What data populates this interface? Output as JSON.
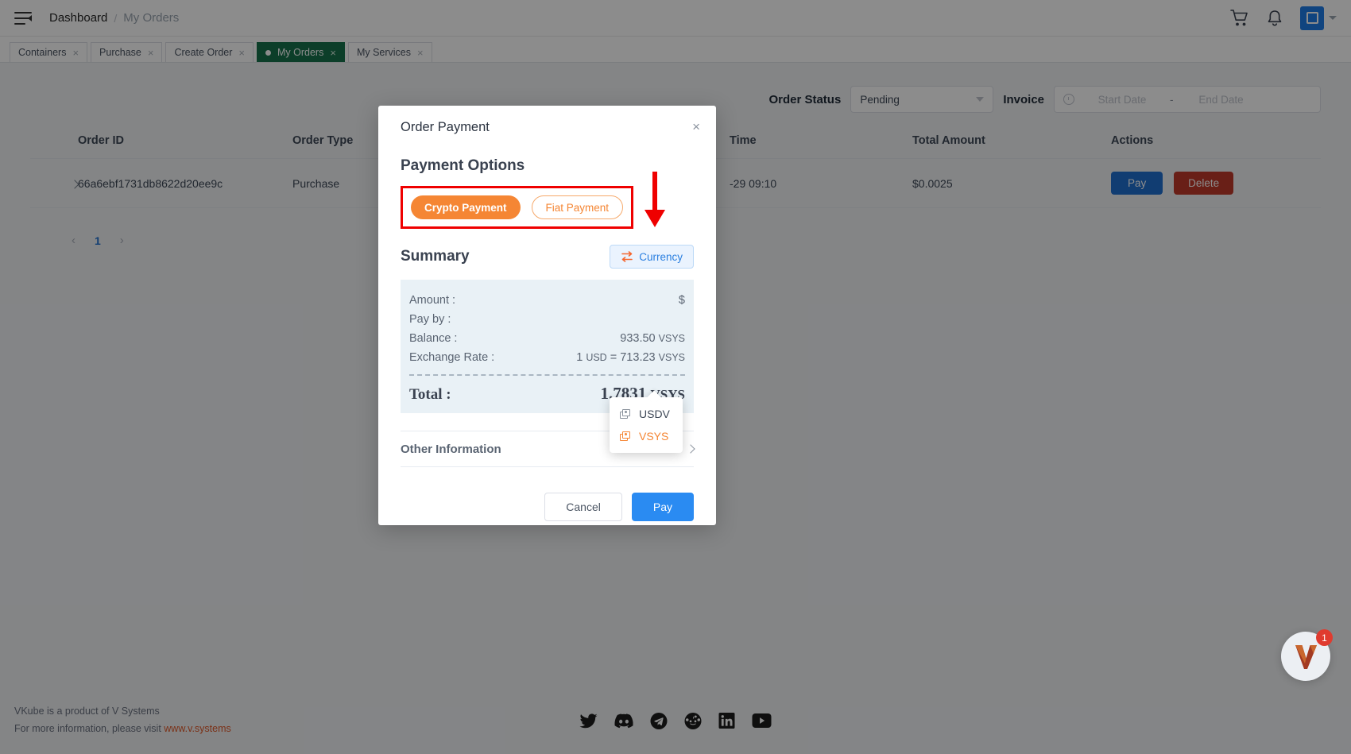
{
  "topbar": {
    "menu_icon": "hamburger-collapse-icon",
    "breadcrumb_root": "Dashboard",
    "breadcrumb_sep": "/",
    "breadcrumb_current": "My Orders",
    "cart_icon": "shopping-cart-icon",
    "bell_icon": "notification-bell-icon",
    "avatar_icon": "user-avatar-icon"
  },
  "tabs": [
    {
      "label": "Containers",
      "active": false,
      "close": "×"
    },
    {
      "label": "Purchase",
      "active": false,
      "close": "×"
    },
    {
      "label": "Create Order",
      "active": false,
      "close": "×"
    },
    {
      "label": "My Orders",
      "active": true,
      "close": "×"
    },
    {
      "label": "My Services",
      "active": false,
      "close": "×"
    }
  ],
  "filters": {
    "order_status_label": "Order Status",
    "order_status_value": "Pending",
    "invoice_label": "Invoice",
    "start_date_placeholder": "Start Date",
    "date_sep": "-",
    "end_date_placeholder": "End Date"
  },
  "table": {
    "columns": [
      "Order ID",
      "Order Type",
      "Time",
      "Total Amount",
      "Actions"
    ],
    "rows": [
      {
        "order_id": "66a6ebf1731db8622d20ee9c",
        "order_type": "Purchase",
        "time": "-29 09:10",
        "total_amount": "$0.0025",
        "pay_label": "Pay",
        "delete_label": "Delete"
      }
    ]
  },
  "pager": {
    "prev": "‹",
    "page": "1",
    "next": "›"
  },
  "modal": {
    "title": "Order Payment",
    "close": "×",
    "payment_options_title": "Payment Options",
    "options": [
      {
        "label": "Crypto Payment",
        "selected": true
      },
      {
        "label": "Fiat Payment",
        "selected": false
      }
    ],
    "summary_title": "Summary",
    "currency_button": "Currency",
    "currency_menu": [
      {
        "label": "USDV",
        "selected": false
      },
      {
        "label": "VSYS",
        "selected": true
      }
    ],
    "summary_rows": [
      {
        "label": "Amount :",
        "value": "$",
        "unit": ""
      },
      {
        "label": "Pay by :",
        "value": "",
        "unit": ""
      },
      {
        "label": "Balance :",
        "value": "933.50",
        "unit": "VSYS"
      },
      {
        "label": "Exchange Rate :",
        "value_prefix": "1",
        "value_unit_a": "USD",
        "value_mid": "= 713.23",
        "unit": "VSYS"
      }
    ],
    "total_label": "Total :",
    "total_value": "1.7831",
    "total_unit": "VSYS",
    "other_information": "Other Information",
    "cancel_label": "Cancel",
    "pay_label": "Pay"
  },
  "footer": {
    "line1": "VKube is a product of V Systems",
    "line2_prefix": "For more information, please visit ",
    "link": "www.v.systems",
    "socials": [
      "twitter-icon",
      "discord-icon",
      "telegram-icon",
      "reddit-icon",
      "linkedin-icon",
      "youtube-icon"
    ]
  },
  "chat": {
    "badge": "1",
    "icon": "v-systems-logo-icon"
  },
  "colors": {
    "accent_orange": "#f58634",
    "primary_blue": "#2a8bf2",
    "tab_active_green": "#16724b",
    "annotation_red": "#ef0000",
    "summary_bg": "#e9f1f6"
  }
}
